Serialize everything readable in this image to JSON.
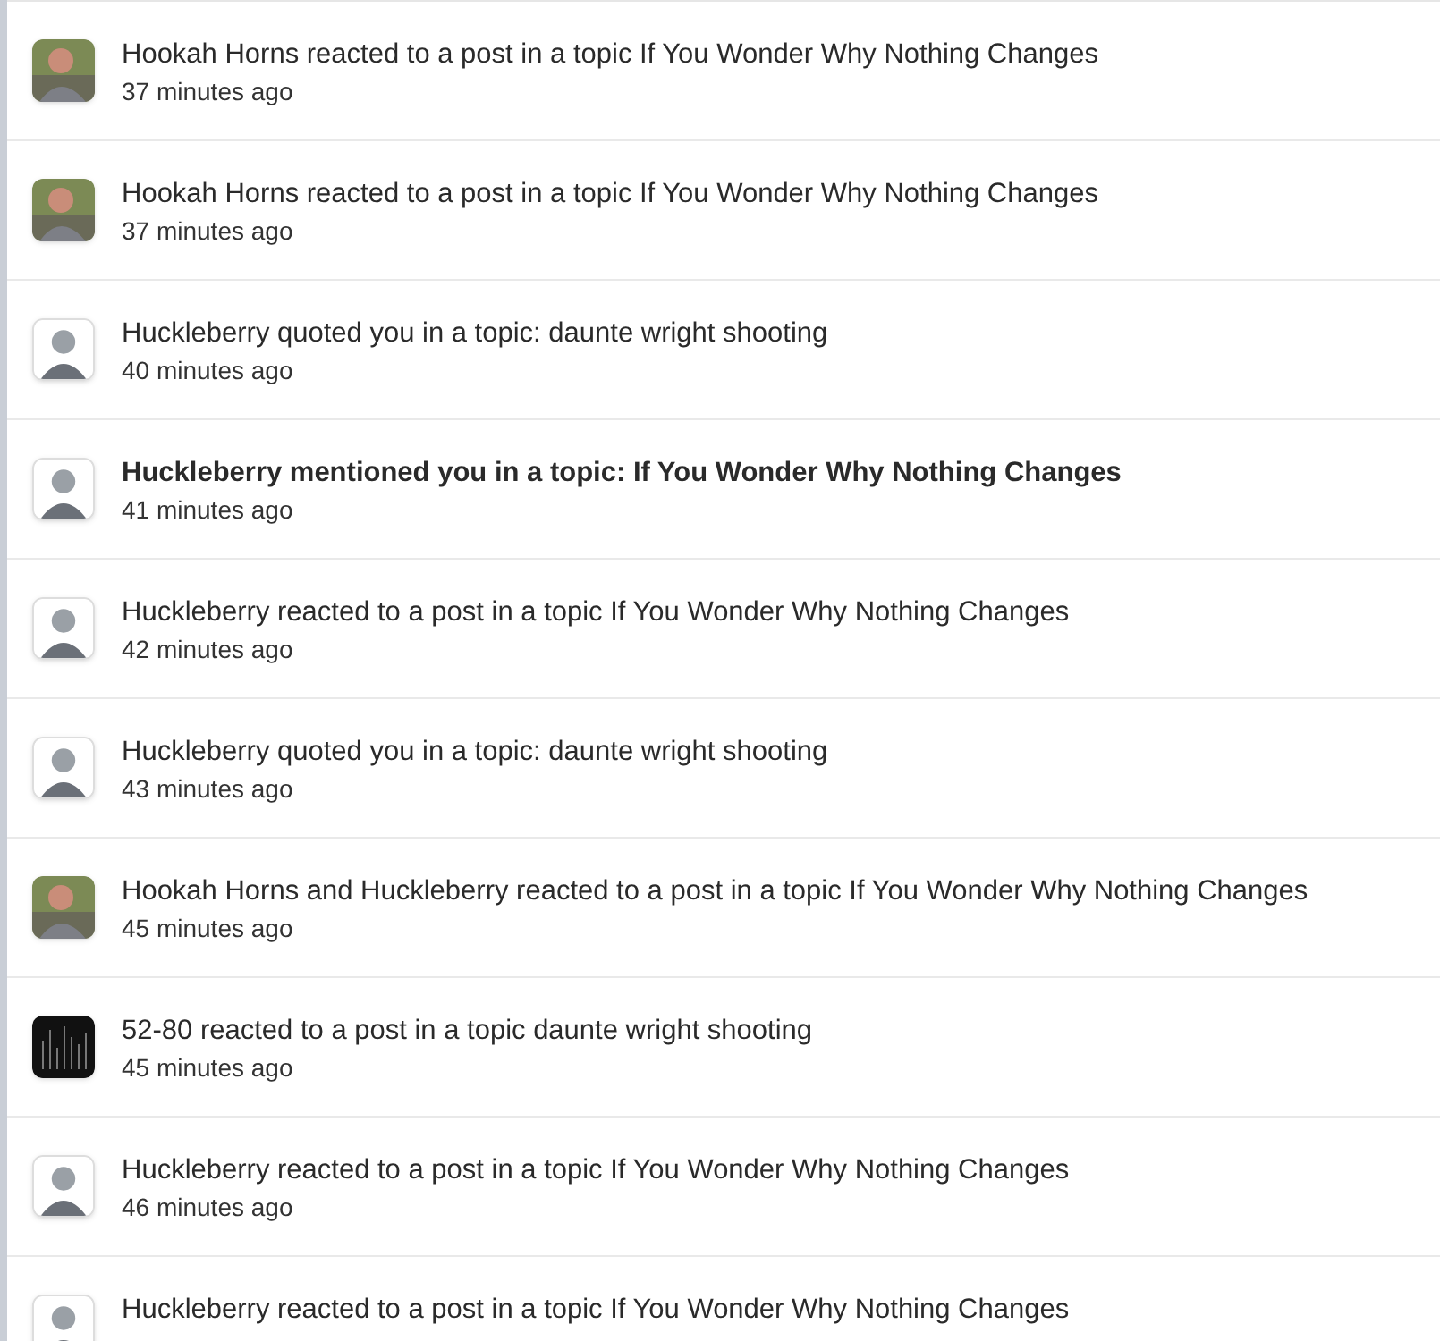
{
  "notifications": [
    {
      "kind": "photo",
      "unread": false,
      "text": "Hookah Horns reacted to a post in a topic If You Wonder Why Nothing Changes",
      "time": "37 minutes ago"
    },
    {
      "kind": "photo",
      "unread": false,
      "text": "Hookah Horns reacted to a post in a topic If You Wonder Why Nothing Changes",
      "time": "37 minutes ago"
    },
    {
      "kind": "cartoon",
      "unread": false,
      "text": "Huckleberry quoted you in a topic: daunte wright shooting",
      "time": "40 minutes ago"
    },
    {
      "kind": "cartoon",
      "unread": true,
      "text": "Huckleberry mentioned you in a topic: If You Wonder Why Nothing Changes",
      "time": "41 minutes ago"
    },
    {
      "kind": "cartoon",
      "unread": false,
      "text": "Huckleberry reacted to a post in a topic If You Wonder Why Nothing Changes",
      "time": "42 minutes ago"
    },
    {
      "kind": "cartoon",
      "unread": false,
      "text": "Huckleberry quoted you in a topic: daunte wright shooting",
      "time": "43 minutes ago"
    },
    {
      "kind": "photo",
      "unread": false,
      "text": "Hookah Horns and Huckleberry reacted to a post in a topic If You Wonder Why Nothing Changes",
      "time": "45 minutes ago"
    },
    {
      "kind": "dark",
      "unread": false,
      "text": "52-80 reacted to a post in a topic daunte wright shooting",
      "time": "45 minutes ago"
    },
    {
      "kind": "cartoon",
      "unread": false,
      "text": "Huckleberry reacted to a post in a topic If You Wonder Why Nothing Changes",
      "time": "46 minutes ago"
    },
    {
      "kind": "cartoon",
      "unread": false,
      "text": "Huckleberry reacted to a post in a topic If You Wonder Why Nothing Changes"
    }
  ]
}
